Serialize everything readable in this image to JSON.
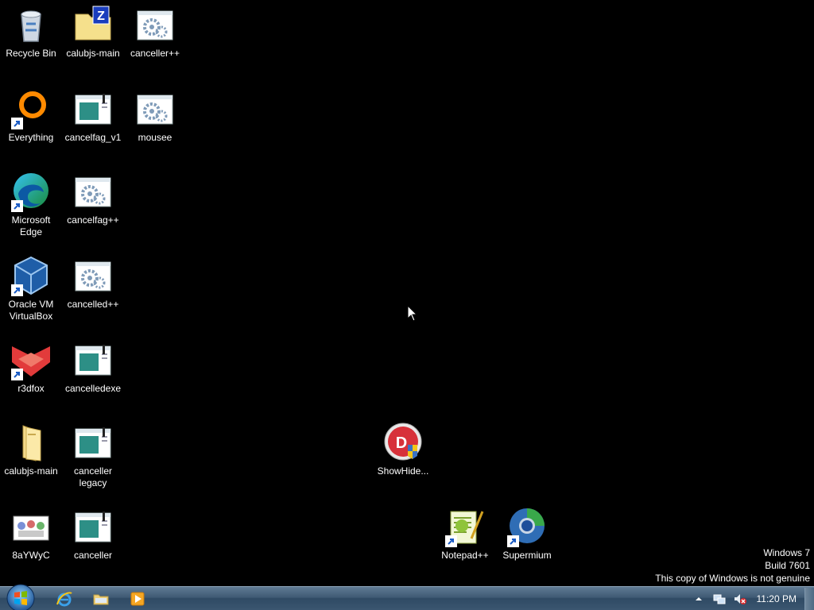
{
  "desktop": {
    "icons": [
      {
        "label": "Recycle Bin",
        "icon": "recycle-bin-icon"
      },
      {
        "label": "calubjs-main",
        "icon": "zip-folder-icon"
      },
      {
        "label": "canceller++",
        "icon": "exe-gears-icon"
      },
      {
        "label": "Everything",
        "icon": "everything-icon"
      },
      {
        "label": "cancelfag_v1",
        "icon": "window-app-icon"
      },
      {
        "label": "mousee",
        "icon": "exe-gears-icon"
      },
      {
        "label": "Microsoft Edge",
        "icon": "edge-icon"
      },
      {
        "label": "cancelfag++",
        "icon": "exe-gears-icon"
      },
      {
        "label": "Oracle VM VirtualBox",
        "icon": "virtualbox-icon"
      },
      {
        "label": "cancelled++",
        "icon": "exe-gears-icon"
      },
      {
        "label": "r3dfox",
        "icon": "r3dfox-icon"
      },
      {
        "label": "cancelledexe",
        "icon": "window-app-icon"
      },
      {
        "label": "calubjs-main",
        "icon": "folder-icon"
      },
      {
        "label": "canceller legacy",
        "icon": "window-app-icon"
      },
      {
        "label": "8aYWyC",
        "icon": "image-file-icon"
      },
      {
        "label": "canceller",
        "icon": "window-app-icon"
      },
      {
        "label": "ShowHide...",
        "icon": "showhide-icon"
      },
      {
        "label": "Notepad++",
        "icon": "notepadpp-icon"
      },
      {
        "label": "Supermium",
        "icon": "supermium-icon"
      }
    ]
  },
  "watermark": {
    "line1": "Windows 7",
    "line2": "Build 7601",
    "line3": "This copy of Windows is not genuine"
  },
  "taskbar": {
    "pinned": [
      "internet-explorer-icon",
      "windows-explorer-icon",
      "media-player-icon"
    ],
    "tray": [
      "show-hidden-icons-icon",
      "network-icon",
      "volume-muted-icon"
    ],
    "clock": "11:20 PM"
  },
  "colors": {
    "desktop_bg": "#000000",
    "taskbar": "#3f5a74"
  }
}
